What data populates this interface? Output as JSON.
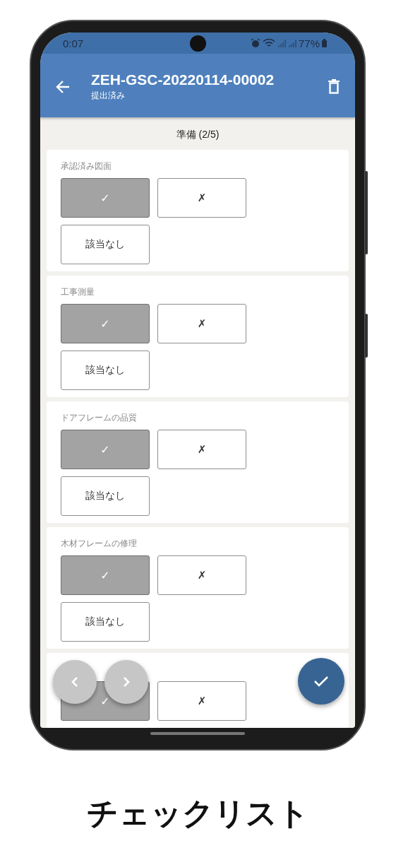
{
  "status_bar": {
    "time": "0:07",
    "battery": "77%"
  },
  "app_bar": {
    "title": "ZEH-GSC-20220114-00002",
    "subtitle": "提出済み"
  },
  "section": {
    "title": "準備 (2/5)"
  },
  "items": [
    {
      "label": "承認済み図面",
      "options": [
        {
          "kind": "check",
          "text": "✓",
          "selected": true
        },
        {
          "kind": "cross",
          "text": "✗",
          "selected": false
        },
        {
          "kind": "na",
          "text": "該当なし",
          "selected": false
        }
      ]
    },
    {
      "label": "工事測量",
      "options": [
        {
          "kind": "check",
          "text": "✓",
          "selected": true
        },
        {
          "kind": "cross",
          "text": "✗",
          "selected": false
        },
        {
          "kind": "na",
          "text": "該当なし",
          "selected": false
        }
      ]
    },
    {
      "label": "ドアフレームの品質",
      "options": [
        {
          "kind": "check",
          "text": "✓",
          "selected": true
        },
        {
          "kind": "cross",
          "text": "✗",
          "selected": false
        },
        {
          "kind": "na",
          "text": "該当なし",
          "selected": false
        }
      ]
    },
    {
      "label": "木材フレームの修理",
      "options": [
        {
          "kind": "check",
          "text": "✓",
          "selected": true
        },
        {
          "kind": "cross",
          "text": "✗",
          "selected": false
        },
        {
          "kind": "na",
          "text": "該当なし",
          "selected": false
        }
      ]
    },
    {
      "options": [
        {
          "kind": "check",
          "text": "✓",
          "selected": true
        },
        {
          "kind": "cross",
          "text": "✗",
          "selected": false
        }
      ]
    }
  ],
  "caption": "チェックリスト"
}
